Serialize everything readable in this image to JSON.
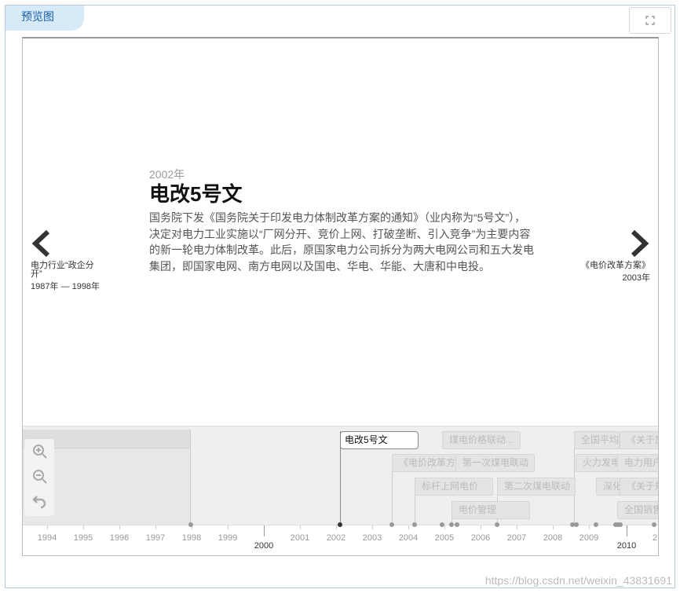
{
  "tab_label": "预览图",
  "icons": {
    "fullscreen": "fullscreen-icon",
    "zoom_in": "zoom-in-icon",
    "zoom_out": "zoom-out-icon",
    "reset": "undo-icon",
    "prev": "chevron-left-icon",
    "next": "chevron-right-icon"
  },
  "slide": {
    "date": "2002年",
    "title": "电改5号文",
    "text": "国务院下发《国务院关于印发电力体制改革方案的通知》（业内称为“5号文”），决定对电力工业实施以“厂网分开、竞价上网、打破垄断、引入竞争”为主要内容的新一轮电力体制改革。此后，原国家电力公司拆分为两大电网公司和五大发电集团，即国家电网、南方电网以及国电、华电、华能、大唐和中电投。"
  },
  "prev": {
    "title": "电力行业“政企分开”",
    "date": "1987年 — 1998年"
  },
  "next": {
    "title": "《电价改革方案》",
    "date": "2003年"
  },
  "markers": [
    {
      "label": "电改5号文",
      "active": true
    },
    {
      "label": "煤电价格联动..."
    },
    {
      "label": "《电价改革方..."
    },
    {
      "label": "第一次煤电联动"
    },
    {
      "label": "标杆上网电价"
    },
    {
      "label": "第二次煤电联动"
    },
    {
      "label": "电价管理"
    },
    {
      "label": "全国平均销"
    },
    {
      "label": "《关于加"
    },
    {
      "label": "火力发电"
    },
    {
      "label": "电力用户"
    },
    {
      "label": "深化"
    },
    {
      "label": "《关于规"
    },
    {
      "label": "全国销售"
    }
  ],
  "axis": {
    "minor_years": [
      "1994",
      "1995",
      "1996",
      "1997",
      "1998",
      "1999",
      "2001",
      "2002",
      "2003",
      "2004",
      "2005",
      "2006",
      "2007",
      "2008",
      "2009",
      "2"
    ],
    "major_years": [
      "2000",
      "2010"
    ]
  },
  "watermark": "https://blog.csdn.net/weixin_43831691"
}
